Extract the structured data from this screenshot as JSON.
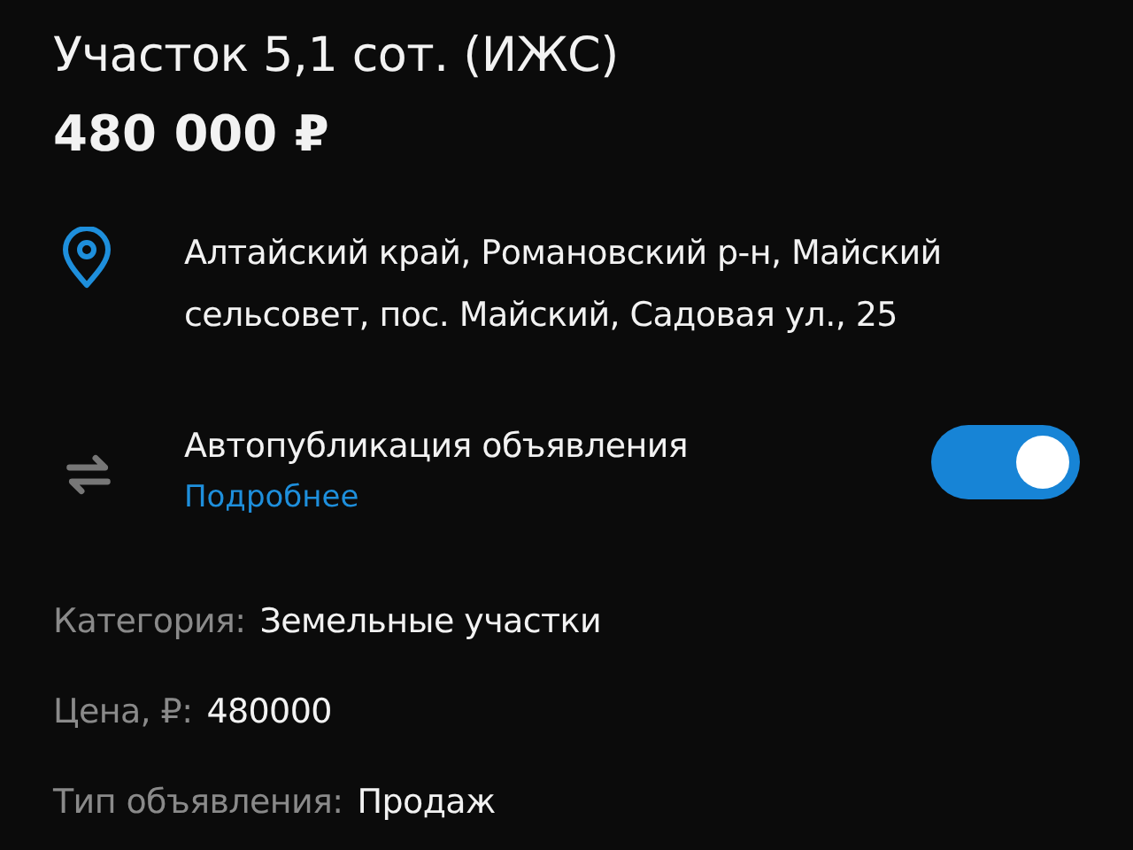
{
  "title": "Участок 5,1 сот. (ИЖС)",
  "price": "480 000 ₽",
  "address": "Алтайский край, Романовский р-н, Майский сельсовет, пос. Майский, Садовая ул., 25",
  "autopublish": {
    "label": "Автопубликация объявления",
    "link": "Подробнее",
    "on": true
  },
  "details": [
    {
      "label": "Категория:",
      "value": "Земельные участки"
    },
    {
      "label": "Цена, ₽:",
      "value": "480000"
    },
    {
      "label": "Тип объявления:",
      "value": "Продаж"
    }
  ]
}
